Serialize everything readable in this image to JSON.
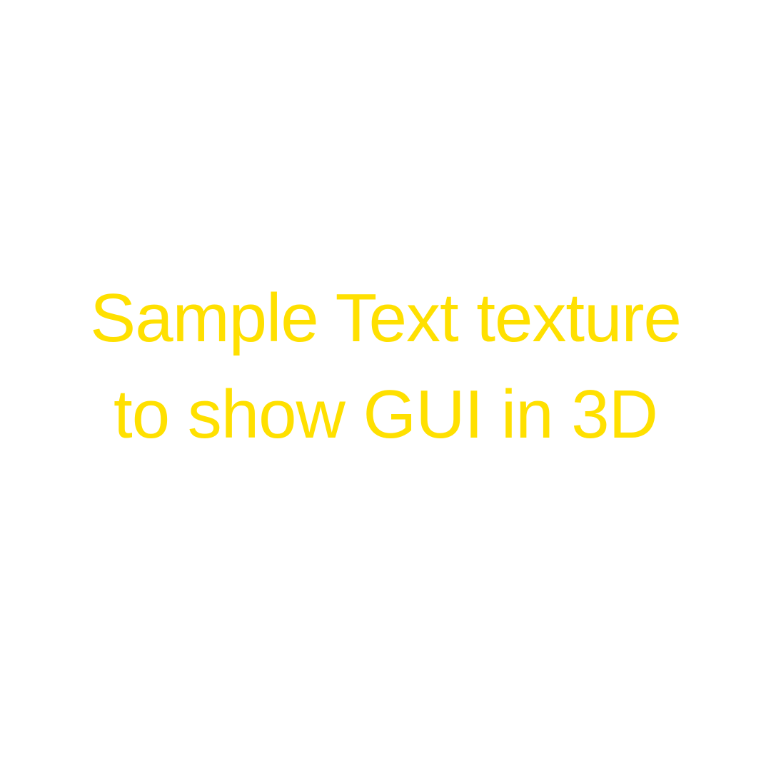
{
  "texture": {
    "line1": "Sample Text texture",
    "line2": "to show GUI in 3D",
    "text_color": "#FFE000",
    "background_color": "#FFFFFF"
  }
}
